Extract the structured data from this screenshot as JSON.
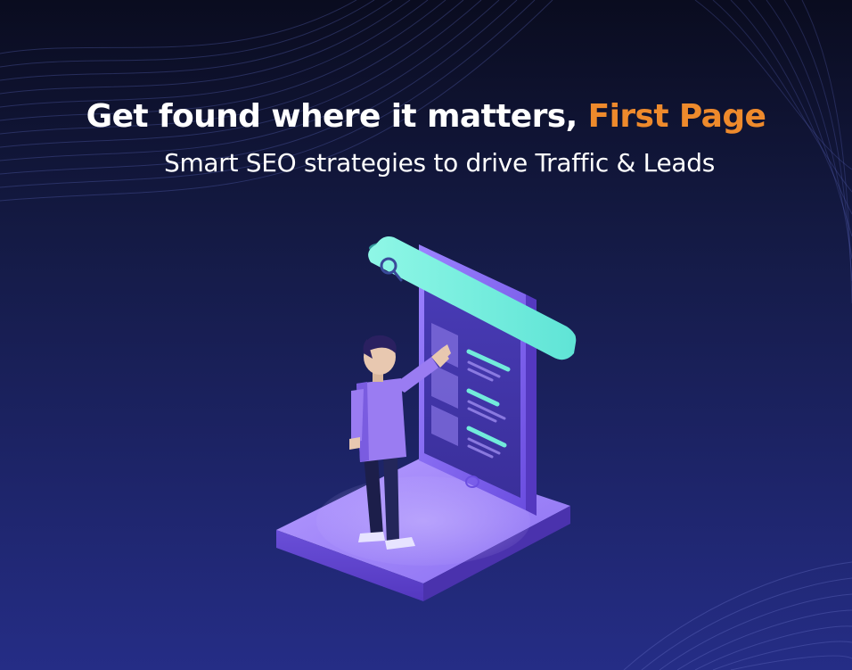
{
  "headline": {
    "main_text": "Get found where it matters,",
    "highlight_text": "First Page"
  },
  "subheadline": "Smart SEO strategies to drive Traffic & Leads",
  "colors": {
    "background_top": "#0a0c1f",
    "background_bottom": "#252d86",
    "headline": "#ffffff",
    "highlight": "#ee8a2c",
    "search_bar": "#6ef0de",
    "phone": "#8a6cf0",
    "platform": "#9a7cf8"
  },
  "illustration": {
    "search_icon": "search-icon",
    "figure": "person-pointing",
    "device": "smartphone"
  }
}
